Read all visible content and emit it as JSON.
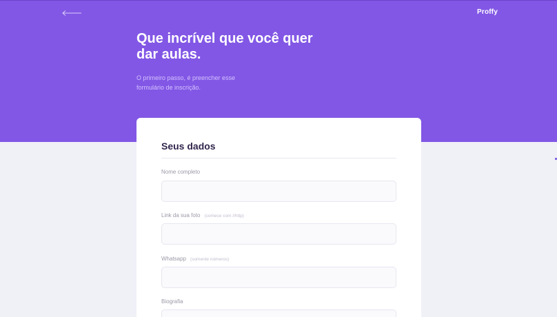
{
  "header": {
    "back_icon": "arrow-left-icon",
    "logo": "Proffy"
  },
  "hero": {
    "title": "Que incrível que você quer dar aulas.",
    "subtitle": "O primeiro passo, é preencher esse formulário de inscrição."
  },
  "form": {
    "section_title": "Seus dados",
    "fields": [
      {
        "label": "Nome completo",
        "hint": "",
        "value": "",
        "placeholder": ""
      },
      {
        "label": "Link da sua foto",
        "hint": "(comece com //http)",
        "value": "",
        "placeholder": ""
      },
      {
        "label": "Whatsapp",
        "hint": "(somente números)",
        "value": "",
        "placeholder": ""
      },
      {
        "label": "Biografia",
        "hint": "",
        "value": "",
        "placeholder": ""
      }
    ]
  },
  "colors": {
    "primary": "#8257e5",
    "background": "#f0f0f7",
    "card": "#ffffff",
    "title_text": "#32264d",
    "label_text": "#9c98a6"
  }
}
